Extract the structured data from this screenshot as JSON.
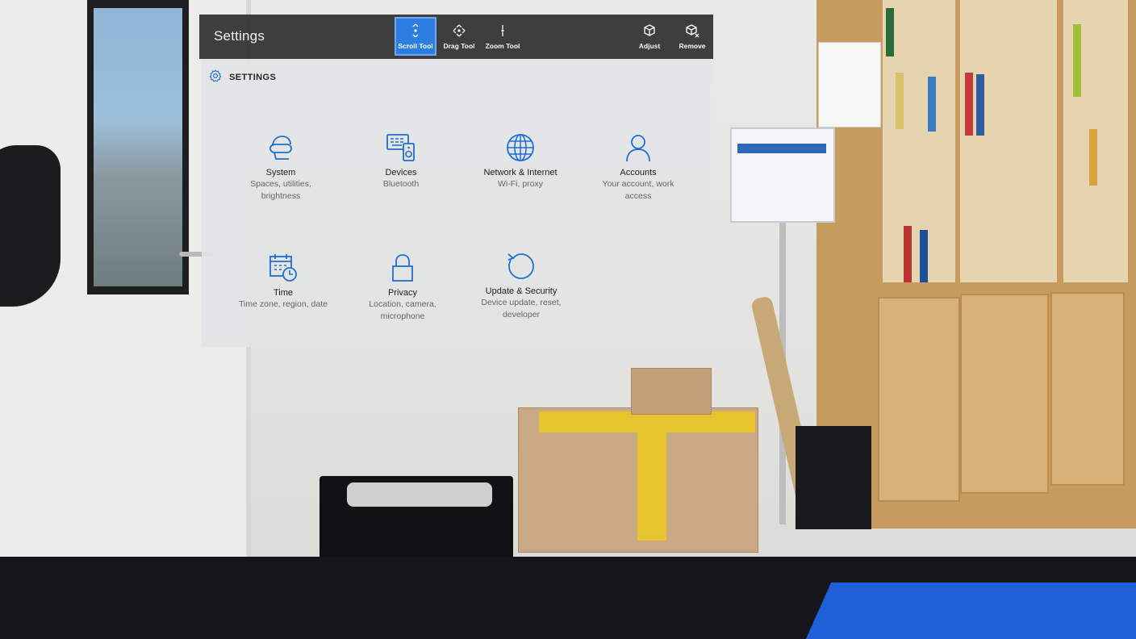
{
  "app": {
    "title": "Settings"
  },
  "toolbar": {
    "tools": [
      {
        "label": "Scroll Tool",
        "icon": "scroll-icon",
        "active": true
      },
      {
        "label": "Drag Tool",
        "icon": "drag-icon",
        "active": false
      },
      {
        "label": "Zoom Tool",
        "icon": "zoom-icon",
        "active": false
      }
    ],
    "actions": [
      {
        "label": "Adjust",
        "icon": "adjust-cube-icon"
      },
      {
        "label": "Remove",
        "icon": "remove-cube-icon"
      }
    ]
  },
  "settings": {
    "header": "SETTINGS",
    "header_icon": "gear-icon",
    "tiles": [
      {
        "title": "System",
        "subtitle": "Spaces, utilities, brightness",
        "icon": "headset-icon"
      },
      {
        "title": "Devices",
        "subtitle": "Bluetooth",
        "icon": "devices-icon"
      },
      {
        "title": "Network & Internet",
        "subtitle": "Wi-Fi, proxy",
        "icon": "globe-icon"
      },
      {
        "title": "Accounts",
        "subtitle": "Your account, work access",
        "icon": "person-icon"
      },
      {
        "title": "Time",
        "subtitle": "Time zone, region, date",
        "icon": "calendar-clock-icon"
      },
      {
        "title": "Privacy",
        "subtitle": "Location, camera, microphone",
        "icon": "lock-icon"
      },
      {
        "title": "Update & Security",
        "subtitle": "Device update, reset, developer",
        "icon": "refresh-icon"
      }
    ]
  },
  "colors": {
    "accent": "#2d7de0",
    "icon_blue": "#1f6fd0",
    "app_bar": "#303030",
    "panel": "#e2e4e6"
  }
}
